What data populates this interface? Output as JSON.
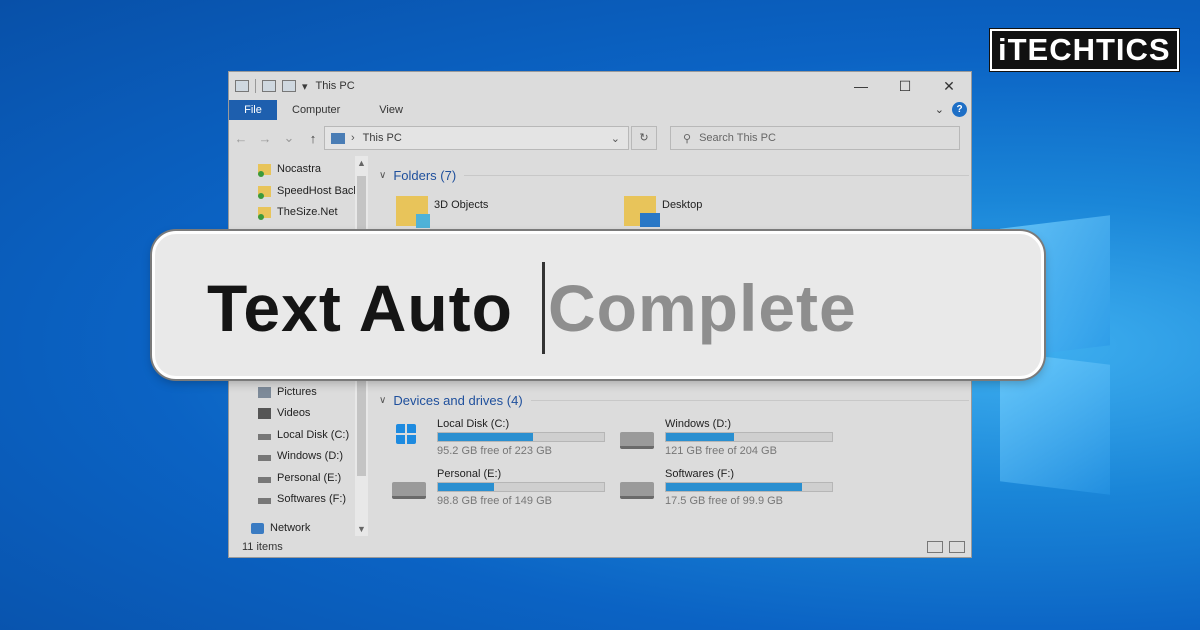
{
  "brand": {
    "logo_text": "iTECHTICS"
  },
  "window": {
    "title": "This PC",
    "controls": [
      "—",
      "☐",
      "✕"
    ]
  },
  "ribbon": {
    "file_tab": "File",
    "tabs": [
      "Computer",
      "View"
    ]
  },
  "nav": {
    "back_icon": "←",
    "forward_icon": "→",
    "recent_icon": "⌄",
    "up_icon": "↑",
    "address": "This PC",
    "search_placeholder": "Search This PC"
  },
  "sidebar": {
    "items": [
      {
        "label": "Nocastra",
        "icon": "folder-icon"
      },
      {
        "label": "SpeedHost Back",
        "icon": "folder-icon"
      },
      {
        "label": "TheSize.Net",
        "icon": "folder-icon"
      },
      {
        "label": "Pictures",
        "icon": "pictures-icon"
      },
      {
        "label": "Videos",
        "icon": "videos-icon"
      },
      {
        "label": "Local Disk (C:)",
        "icon": "drive-icon"
      },
      {
        "label": "Windows (D:)",
        "icon": "drive-icon"
      },
      {
        "label": "Personal (E:)",
        "icon": "drive-icon"
      },
      {
        "label": "Softwares (F:)",
        "icon": "drive-icon"
      },
      {
        "label": "Network",
        "icon": "network-icon"
      }
    ]
  },
  "folders": {
    "header": "Folders (7)",
    "items": [
      "3D Objects",
      "Desktop"
    ]
  },
  "drives": {
    "header": "Devices and drives (4)",
    "items": [
      {
        "name": "Local Disk (C:)",
        "free": "95.2 GB free of 223 GB",
        "used_fraction": 0.57
      },
      {
        "name": "Windows (D:)",
        "free": "121 GB free of 204 GB",
        "used_fraction": 0.41
      },
      {
        "name": "Personal (E:)",
        "free": "98.8 GB free of 149 GB",
        "used_fraction": 0.34
      },
      {
        "name": "Softwares (F:)",
        "free": "17.5 GB free of 99.9 GB",
        "used_fraction": 0.82
      }
    ]
  },
  "status": {
    "count": "11 items"
  },
  "banner": {
    "typed": "Text Auto",
    "suggestion": "Complete"
  },
  "colors": {
    "accent": "#1e5fae",
    "drive_bar": "#2a8fd0"
  }
}
